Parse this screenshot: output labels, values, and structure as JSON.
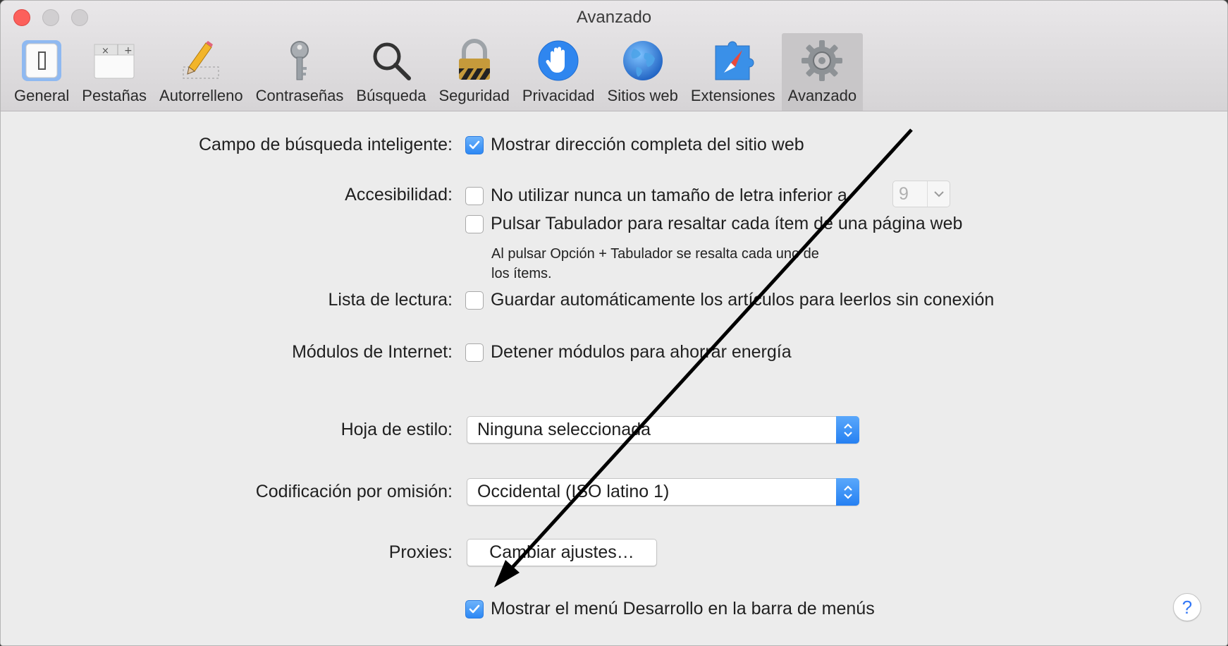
{
  "window": {
    "title": "Avanzado"
  },
  "toolbar": {
    "items": [
      {
        "label": "General",
        "icon": "general-switch-icon"
      },
      {
        "label": "Pestañas",
        "icon": "tabs-icon"
      },
      {
        "label": "Autorrelleno",
        "icon": "pencil-icon"
      },
      {
        "label": "Contraseñas",
        "icon": "key-icon"
      },
      {
        "label": "Búsqueda",
        "icon": "magnifier-icon"
      },
      {
        "label": "Seguridad",
        "icon": "padlock-icon"
      },
      {
        "label": "Privacidad",
        "icon": "hand-icon"
      },
      {
        "label": "Sitios web",
        "icon": "globe-icon"
      },
      {
        "label": "Extensiones",
        "icon": "puzzle-compass-icon"
      },
      {
        "label": "Avanzado",
        "icon": "gear-icon"
      }
    ],
    "active": "Avanzado"
  },
  "settings": {
    "smart_search": {
      "label": "Campo de búsqueda inteligente:",
      "option": "Mostrar dirección completa del sitio web",
      "checked": true
    },
    "accessibility": {
      "label": "Accesibilidad:",
      "option1": "No utilizar nunca un tamaño de letra inferior a",
      "option1_value": "9",
      "option1_checked": false,
      "option2": "Pulsar Tabulador para resaltar cada ítem de una página web",
      "option2_checked": false,
      "note_line1": "Al pulsar Opción + Tabulador se resalta cada uno de",
      "note_line2": "los ítems."
    },
    "reading_list": {
      "label": "Lista de lectura:",
      "option": "Guardar automáticamente los artículos para leerlos sin conexión",
      "checked": false
    },
    "plugins": {
      "label": "Módulos de Internet:",
      "option": "Detener módulos para ahorrar energía",
      "checked": false
    },
    "stylesheet": {
      "label": "Hoja de estilo:",
      "value": "Ninguna seleccionada"
    },
    "encoding": {
      "label": "Codificación por omisión:",
      "value": "Occidental (ISO latino 1)"
    },
    "proxies": {
      "label": "Proxies:",
      "button": "Cambiar ajustes…"
    },
    "develop_menu": {
      "option": "Mostrar el menú Desarrollo en la barra de menús",
      "checked": true
    },
    "help": "?"
  },
  "colors": {
    "accent": "#2c88f4",
    "window_bg": "#ececec",
    "annotation_arrow": "#000000"
  }
}
